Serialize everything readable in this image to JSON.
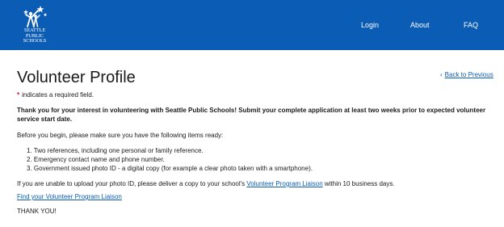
{
  "header": {
    "logo_lines": [
      "SEATTLE",
      "PUBLIC",
      "SCHOOLS"
    ],
    "nav": [
      {
        "label": "Login"
      },
      {
        "label": "About"
      },
      {
        "label": "FAQ"
      }
    ],
    "background_color": "#0b5cb4"
  },
  "main": {
    "title": "Volunteer Profile",
    "back_link": {
      "icon": "chevron-left-icon",
      "label": "Back to Previous"
    },
    "required_star": "*",
    "required_note": "indicates a required field.",
    "intro_bold_line1": "Thank you for your interest in volunteering with Seattle Public Schools! Submit your complete application at least two weeks prior to expected volunteer",
    "intro_bold_line2": "service start date.",
    "before_begin": "Before you begin, please make sure you have the following items ready:",
    "items": [
      "1. Two references, including one personal or family reference.",
      "2. Emergency contact name and phone number.",
      "3. Government issued photo ID - a digital copy (for example a clear photo taken with a smartphone)."
    ],
    "upload_note_prefix": "If you are unable to upload your photo ID, please deliver a copy to your school's ",
    "upload_note_link": "Volunteer Program Liaison",
    "upload_note_suffix": " within 10 business days.",
    "find_liaison_link": "Find your Volunteer Program Liaison",
    "thanks": "THANK YOU!"
  }
}
